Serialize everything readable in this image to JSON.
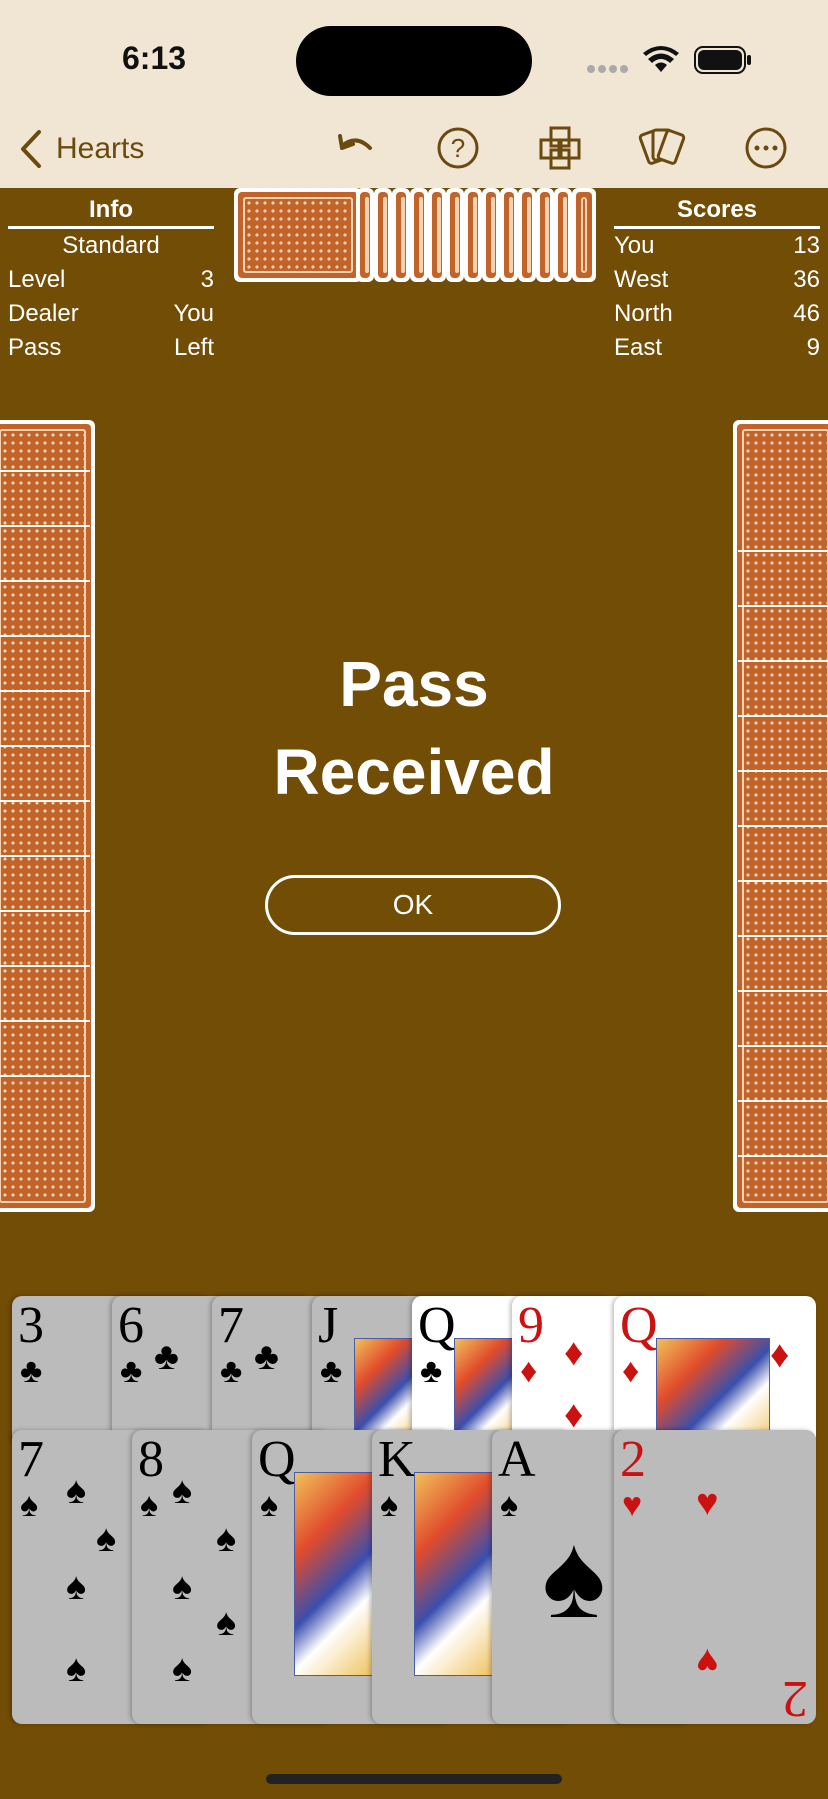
{
  "status": {
    "time": "6:13"
  },
  "nav": {
    "back_label": "Hearts"
  },
  "info": {
    "title": "Info",
    "mode": "Standard",
    "rows": [
      {
        "label": "Level",
        "value": "3"
      },
      {
        "label": "Dealer",
        "value": "You"
      },
      {
        "label": "Pass",
        "value": "Left"
      }
    ]
  },
  "scores": {
    "title": "Scores",
    "rows": [
      {
        "label": "You",
        "value": "13"
      },
      {
        "label": "West",
        "value": "36"
      },
      {
        "label": "North",
        "value": "46"
      },
      {
        "label": "East",
        "value": "9"
      }
    ]
  },
  "dialog": {
    "title": "Pass Received",
    "ok_label": "OK"
  },
  "hand": {
    "back_row": [
      {
        "rank": "3",
        "suit": "♣",
        "color": "black"
      },
      {
        "rank": "6",
        "suit": "♣",
        "color": "black"
      },
      {
        "rank": "7",
        "suit": "♣",
        "color": "black"
      },
      {
        "rank": "J",
        "suit": "♣",
        "color": "black"
      },
      {
        "rank": "Q",
        "suit": "♣",
        "color": "black"
      },
      {
        "rank": "9",
        "suit": "♦",
        "color": "red"
      },
      {
        "rank": "Q",
        "suit": "♦",
        "color": "red"
      }
    ],
    "front_row": [
      {
        "rank": "7",
        "suit": "♠",
        "color": "black"
      },
      {
        "rank": "8",
        "suit": "♠",
        "color": "black"
      },
      {
        "rank": "Q",
        "suit": "♠",
        "color": "black"
      },
      {
        "rank": "K",
        "suit": "♠",
        "color": "black"
      },
      {
        "rank": "A",
        "suit": "♠",
        "color": "black"
      },
      {
        "rank": "2",
        "suit": "♥",
        "color": "red"
      }
    ]
  },
  "colors": {
    "table": "#724d06",
    "bar": "#f0e6d3",
    "accent": "#6b4a10",
    "card_back": "#c2632a"
  }
}
